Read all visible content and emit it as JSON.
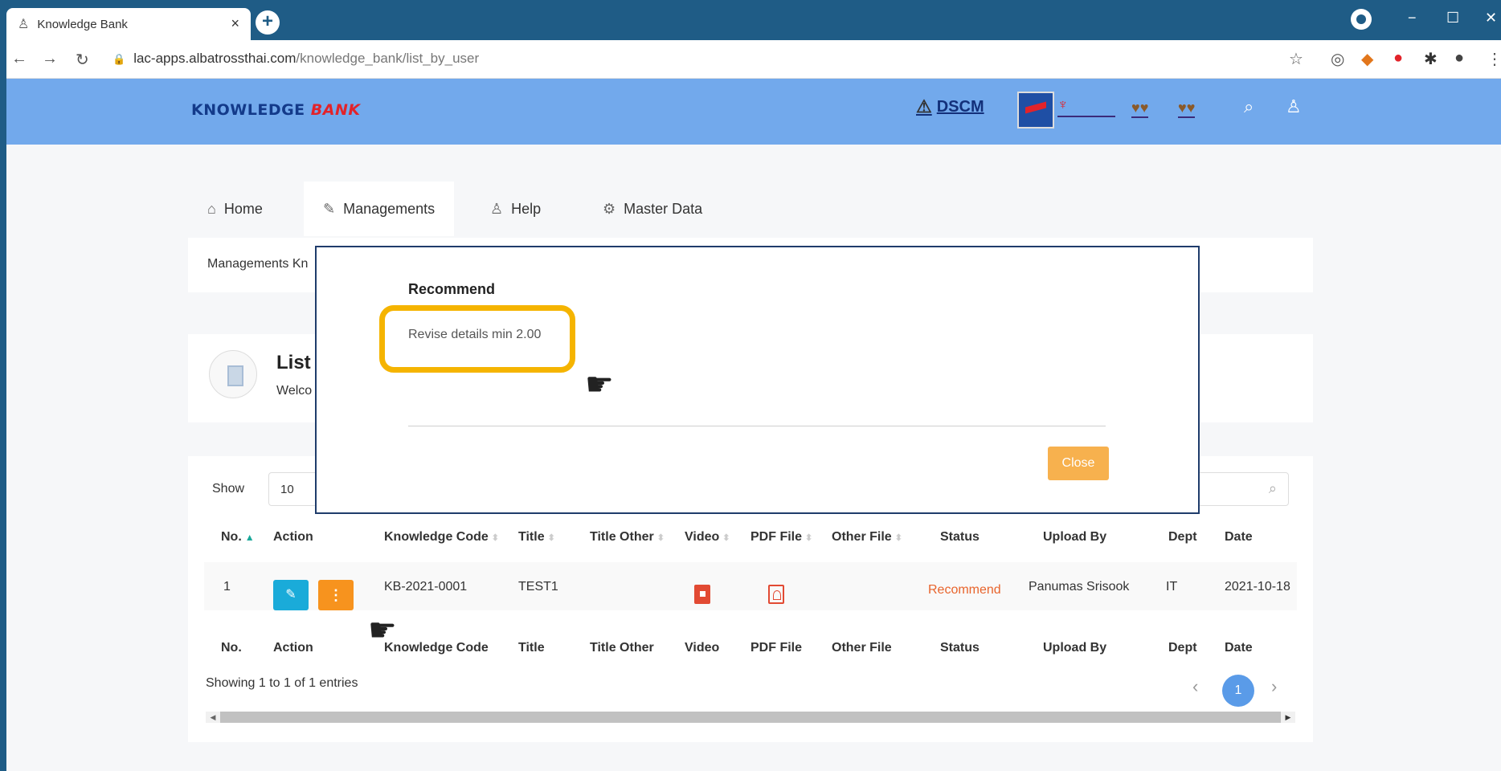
{
  "browser": {
    "tab_title": "Knowledge Bank",
    "tab_close": "×",
    "new_tab": "+",
    "url_host": "lac-apps.albatrossthai.com",
    "url_path": "/knowledge_bank/list_by_user",
    "window_controls": [
      "−",
      "☐",
      "✕"
    ]
  },
  "header": {
    "brand_part1": "KNOWLEDGE ",
    "brand_part2": "BANK",
    "partner_logo": "DSCM"
  },
  "nav": {
    "tabs": [
      {
        "label": "Home",
        "icon": "home-icon"
      },
      {
        "label": "Managements",
        "icon": "pencil-icon"
      },
      {
        "label": "Help",
        "icon": "support-icon"
      },
      {
        "label": "Master Data",
        "icon": "gear-icon"
      }
    ]
  },
  "breadcrumb": "Managements Kn",
  "page_title": {
    "title": "List",
    "subtitle": "Welco"
  },
  "table": {
    "show_label": "Show",
    "page_size": "10",
    "headers": [
      "No.",
      "Action",
      "Knowledge Code",
      "Title",
      "Title Other",
      "Video",
      "PDF File",
      "Other File",
      "Status",
      "Upload By",
      "Dept",
      "Date"
    ],
    "rows": [
      {
        "no": "1",
        "knowledge_code": "KB-2021-0001",
        "title": "TEST1",
        "title_other": "",
        "other_file": "",
        "status": "Recommend",
        "upload_by": "Panumas Srisook",
        "dept": "IT",
        "date": "2021-10-18"
      }
    ],
    "info": "Showing 1 to 1 of 1 entries",
    "current_page": "1",
    "status_color": "#e8642c"
  },
  "modal": {
    "title": "Recommend",
    "message": "Revise details min 2.00",
    "close_label": "Close"
  }
}
